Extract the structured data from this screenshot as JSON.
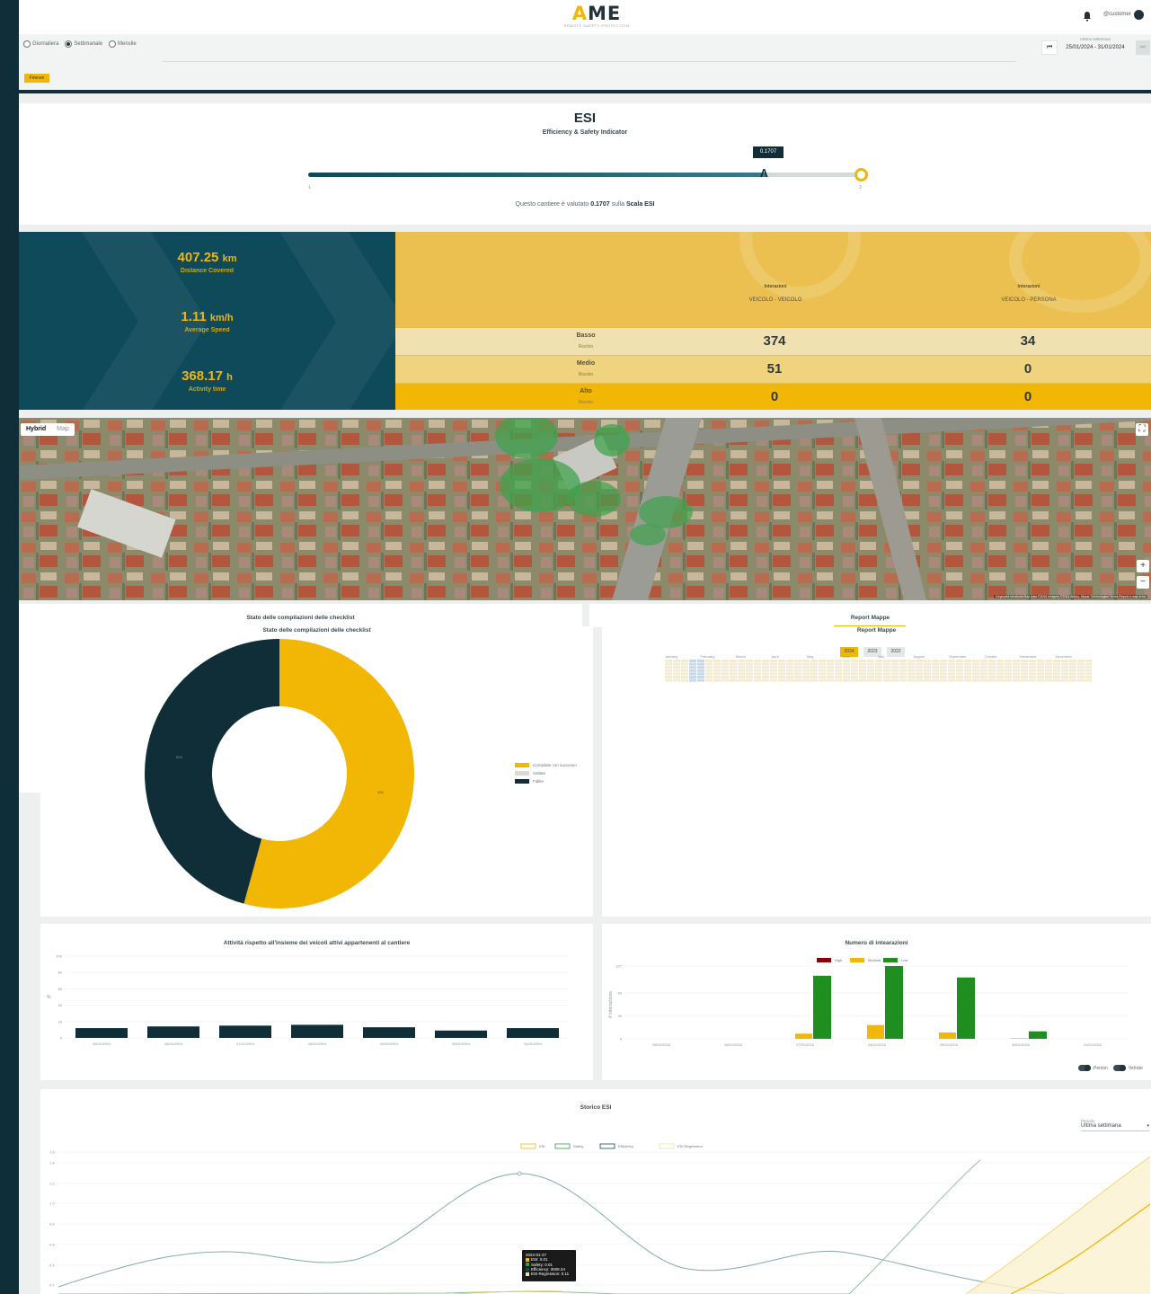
{
  "header": {
    "logo_text": "AME",
    "logo_tagline": "REMOTE SAFETY PROTECTION",
    "user_name": "@customer"
  },
  "filters": {
    "options": [
      {
        "label": "Giornaliera",
        "selected": false
      },
      {
        "label": "Settimanale",
        "selected": true
      },
      {
        "label": "Mensile",
        "selected": false
      }
    ],
    "period_label": "Ultima settimana",
    "period_range": "25/01/2024 - 31/01/2024",
    "prev_icon": "skip-back-icon",
    "next_icon": "skip-forward-icon",
    "site": "Firenze"
  },
  "esi": {
    "title": "ESI",
    "subtitle": "Efficiency & Safety Indicator",
    "value": "0.1707",
    "scale_min": "1",
    "scale_max": "3",
    "fill_fraction": 0.83,
    "sentence_prefix": "Questo cantiere è valutato",
    "sentence_value": "0.1707",
    "sentence_middle": "sulla",
    "sentence_scale": "Scala ESI"
  },
  "stats": [
    {
      "value": "407.25",
      "unit": "km",
      "label": "Distance Covered"
    },
    {
      "value": "1.11",
      "unit": "km/h",
      "label": "Average Speed"
    },
    {
      "value": "368.17",
      "unit": "h",
      "label": "Activity time"
    }
  ],
  "interactions": {
    "columns": [
      {
        "title": "Interazioni",
        "subtitle": "VEICOLO - VEICOLO"
      },
      {
        "title": "Interazioni",
        "subtitle": "VEICOLO - PERSONA"
      }
    ],
    "rows": [
      {
        "name": "Basso",
        "sub": "Rischio",
        "v1": "374",
        "v2": "34",
        "bg": "#f1e0b0"
      },
      {
        "name": "Medio",
        "sub": "Rischio",
        "v1": "51",
        "v2": "0",
        "bg": "#efd37f"
      },
      {
        "name": "Alto",
        "sub": "Rischio",
        "v1": "0",
        "v2": "0",
        "bg": "#f2b705"
      }
    ]
  },
  "map": {
    "tabs": [
      "Hybrid",
      "Map"
    ],
    "active_tab": "Hybrid",
    "credits": "Keyboard shortcuts   Map data ©2024 Imagery ©2024 Airbus, Maxar Technologies   Terms   Report a map error"
  },
  "checklist": {
    "title": "Stato delle compilazioni delle checklist",
    "legend": [
      {
        "label": "Compilate con successo",
        "color": "#f2b705"
      },
      {
        "label": "Saltate",
        "color": "#d9d9d9"
      },
      {
        "label": "Fallite",
        "color": "#0f2e38"
      }
    ],
    "slice_labels": [
      "300",
      "503"
    ]
  },
  "report_mappe": {
    "title": "Report Mappe",
    "years": [
      "2024",
      "2023",
      "2022"
    ],
    "active_year": "2024",
    "months": [
      "January",
      "February",
      "March",
      "April",
      "May",
      "June",
      "July",
      "August",
      "September",
      "October",
      "November",
      "December"
    ]
  },
  "activity_chart": {
    "title": "Attività rispetto all'insieme dei veicoli attivi appartenenti al cantiere",
    "ylabel": "%"
  },
  "interactions_chart": {
    "title": "Numero di intearazioni",
    "ylabel": "# interactions",
    "toggles": [
      "Person",
      "Vehicle"
    ]
  },
  "storico": {
    "title": "Storico ESI",
    "period_label": "Periodo",
    "period_value": "Ultima settimana",
    "tooltip": {
      "date": "2024-01-27",
      "lines": [
        {
          "text": "ESI: 0.01",
          "color": "#f2b705"
        },
        {
          "text": "Safety: 0.01",
          "color": "#2e9e3e"
        },
        {
          "text": "Efficiency: 3008.34",
          "color": "#0f4a58"
        },
        {
          "text": "ESI Regression: 0.11",
          "color": "#f5e2a0"
        }
      ]
    }
  },
  "chart_data": [
    {
      "type": "pie",
      "title": "Stato delle compilazioni delle checklist",
      "labels": [
        "Compilate con successo",
        "Saltate",
        "Fallite"
      ],
      "values": [
        300,
        0,
        253
      ],
      "slice_labels": [
        "300",
        "503"
      ],
      "donut": true,
      "legend": "right"
    },
    {
      "type": "bar",
      "title": "Attività rispetto all'insieme dei veicoli attivi appartenenti al cantiere",
      "categories": [
        "25/01/2024",
        "26/01/2024",
        "27/01/2024",
        "28/01/2024",
        "29/01/2024",
        "30/01/2024",
        "31/01/2024"
      ],
      "values": [
        12,
        14,
        15,
        16,
        13,
        9,
        12
      ],
      "ylabel": "%",
      "ylim": [
        0,
        100
      ],
      "yticks": [
        0,
        20,
        40,
        60,
        80,
        100
      ],
      "grid": true
    },
    {
      "type": "bar",
      "title": "Numero di intearazioni",
      "categories": [
        "25/01/2024",
        "26/01/2024",
        "27/01/2024",
        "28/01/2024",
        "29/01/2024",
        "30/01/2024",
        "31/01/2024"
      ],
      "series": [
        {
          "name": "High",
          "color": "#8b0000",
          "values": [
            0,
            0,
            0,
            0,
            0,
            0,
            0
          ]
        },
        {
          "name": "Medium",
          "color": "#f2b705",
          "values": [
            0,
            0,
            9,
            24,
            11,
            1,
            0
          ]
        },
        {
          "name": "Low",
          "color": "#1e8f1e",
          "values": [
            0,
            0,
            110,
            127,
            107,
            13,
            0
          ]
        }
      ],
      "ylabel": "# interactions",
      "ylim": [
        0,
        127
      ],
      "yticks": [
        0,
        40,
        80,
        127
      ],
      "legend": "top"
    },
    {
      "type": "line",
      "title": "Storico ESI",
      "series_names": [
        "ESI",
        "Safety",
        "Efficiency",
        "ESI Regression"
      ],
      "yticks": [
        "0.2",
        "0.4",
        "0.6",
        "0.8",
        "1.0",
        "1.2",
        "1.4",
        "1.6"
      ],
      "legend": "top"
    }
  ]
}
